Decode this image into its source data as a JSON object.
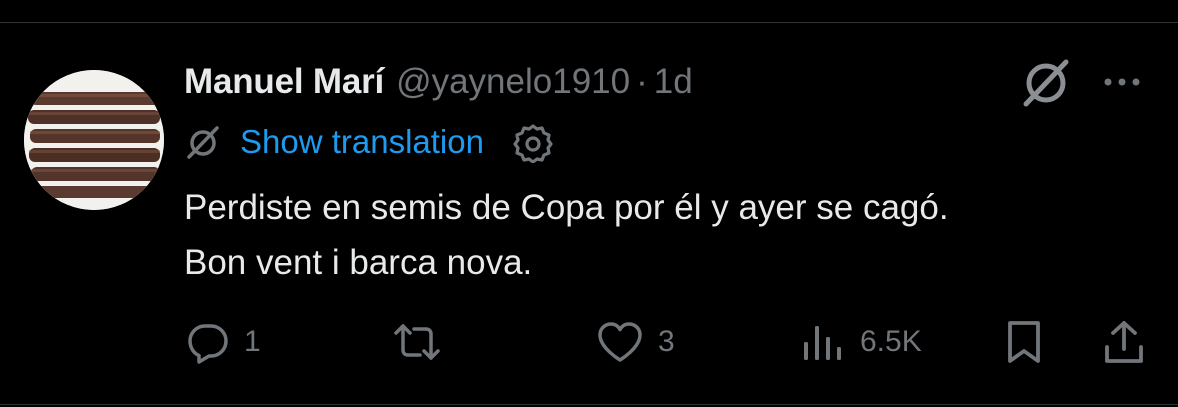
{
  "tweet": {
    "author": {
      "display_name": "Manuel Marí",
      "handle": "@yaynelo1910",
      "avatar_icon": "avatar-cigars"
    },
    "separator": "·",
    "time": "1d",
    "translation": {
      "icon": "translate-slash-icon",
      "label": "Show translation",
      "settings_icon": "gear-icon"
    },
    "text_lines": [
      "Perdiste en semis de Copa por él y ayer se cagó.",
      "Bon vent i barca nova."
    ],
    "actions": {
      "reply": {
        "icon": "reply-icon",
        "count": "1"
      },
      "retweet": {
        "icon": "retweet-icon",
        "count": ""
      },
      "like": {
        "icon": "heart-icon",
        "count": "3"
      },
      "views": {
        "icon": "views-icon",
        "count": "6.5K"
      },
      "bookmark": {
        "icon": "bookmark-icon"
      },
      "share": {
        "icon": "share-icon"
      }
    }
  },
  "colors": {
    "background": "#000000",
    "text_primary": "#e7e9ea",
    "text_secondary": "#71767b",
    "link": "#1d9bf0",
    "divider": "#2f3336"
  }
}
